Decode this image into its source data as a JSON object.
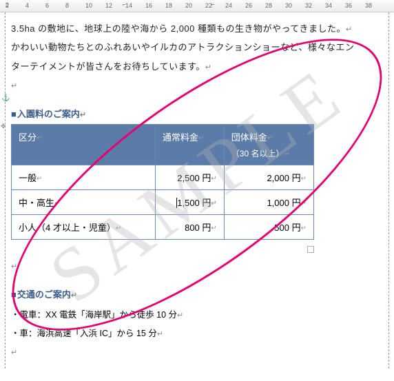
{
  "ruler": {
    "numbers": [
      2,
      4,
      6,
      8,
      10,
      12,
      14,
      16,
      18,
      20,
      22,
      24,
      26,
      28,
      30,
      32,
      34,
      36,
      38
    ]
  },
  "paragraphs": {
    "intro1": "3.5ha の敷地に、地球上の陸や海から 2,000 種類もの生き物がやってきました。",
    "intro2": "かわいい動物たちとのふれあいやイルカのアトラクションショーなど、様々なエン",
    "intro3": "ターテイメントが皆さんをお待ちしています。"
  },
  "sections": {
    "fees_heading": "入園料のご案内",
    "access_heading": "交通のご案内"
  },
  "table": {
    "head": {
      "category": "区分",
      "regular": "通常料金",
      "group": "団体料金",
      "group_sub": "（30 名以上）"
    },
    "rows": [
      {
        "cat": "一般",
        "regular": "2,500 円",
        "group": "2,000 円"
      },
      {
        "cat": "中・高生",
        "regular": "1,500 円",
        "group": "1,000 円"
      },
      {
        "cat": "小人（4 才以上・児童）",
        "regular": "800 円",
        "group": "500 円"
      }
    ]
  },
  "access": {
    "train": "電車：XX 電鉄「海岸駅」から徒歩 10 分",
    "car": "車：海浜高速「入浜 IC」から 15 分"
  },
  "watermark": "SAMPLE"
}
